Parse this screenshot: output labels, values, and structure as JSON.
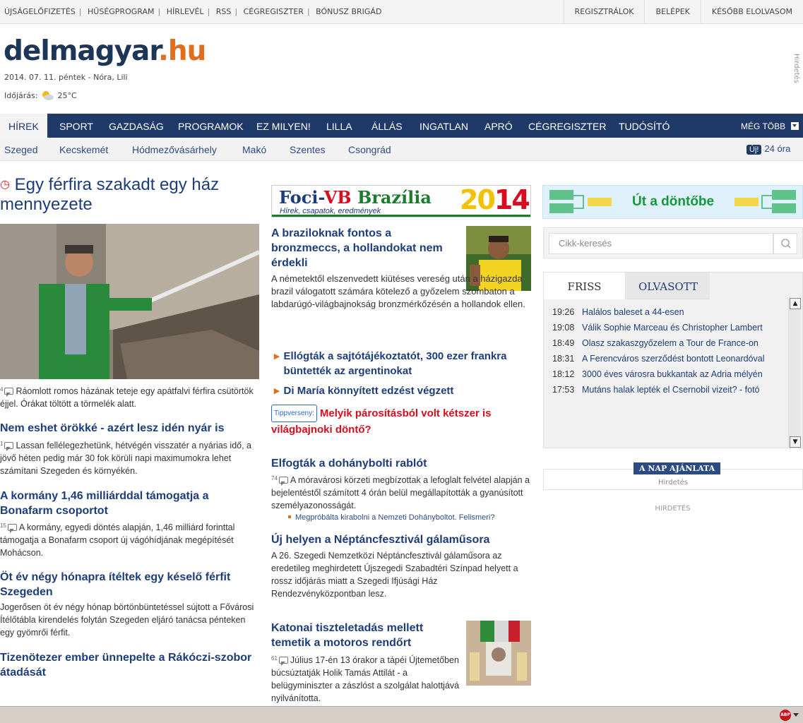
{
  "topbar": {
    "links": [
      "ÚJSÁGELŐFIZETÉS",
      "HŰSÉGPROGRAM",
      "HÍRLEVÉL",
      "RSS",
      "CÉGREGISZTER",
      "BÓNUSZ BRIGÁD"
    ],
    "right": [
      "REGISZTRÁLOK",
      "BELÉPEK",
      "KÉSŐBB ELOLVASOM"
    ]
  },
  "header": {
    "logo_main": "delmagyar",
    "logo_tld": ".hu",
    "date": "2014. 07. 11. péntek - Nóra, Lili",
    "weather_label": "Időjárás:",
    "weather_icon": "partly-cloudy-icon",
    "temperature": "25°C",
    "ad_vertical": "Hirdetés"
  },
  "nav": {
    "items": [
      "HÍREK",
      "SPORT",
      "GAZDASÁG",
      "PROGRAMOK",
      "EZ MILYEN!",
      "LILLA",
      "ÁLLÁS",
      "INGATLAN",
      "APRÓ",
      "CÉGREGISZTER",
      "TUDÓSÍTÓ"
    ],
    "more": "MÉG TÖBB"
  },
  "subnav": {
    "cities": [
      "Szeged",
      "Kecskemét",
      "Hódmezővásárhely",
      "Makó",
      "Szentes",
      "Csongrád"
    ],
    "uj_badge": "Új!",
    "uj_text": "24 óra"
  },
  "left": {
    "lead_title": "Egy férfira szakadt egy ház mennyezete",
    "lead_count": "4",
    "lead_body": "Ráomlott romos házának teteje egy apátfalvi férfira csütörtök éjjel. Órákat töltött a törmelék alatt.",
    "articles": [
      {
        "title": "Nem eshet örökké - azért lesz idén nyár is",
        "count": "1",
        "body": "Lassan fellélegezhetünk, hétvégén visszatér a nyárias idő, a jövő héten pedig már 30 fok körüli napi maximumokra lehet számítani Szegeden és környékén."
      },
      {
        "title": "A kormány 1,46 milliárddal támogatja a Bonafarm csoportot",
        "count": "15",
        "body": "A kormány, egyedi döntés alapján, 1,46 milliárd forinttal támogatja a Bonafarm csoport új vágóhídjának megépítését Mohácson."
      },
      {
        "title": "Öt év négy hónapra ítéltek egy késelő férfit Szegeden",
        "count": "",
        "body": "Jogerősen öt év négy hónap börtönbüntetéssel sújtott a Fővárosi Ítélőtábla kirendelés folytán Szegeden eljáró tanácsa pénteken egy gyömrői férfit."
      },
      {
        "title": "Tizenötezer ember ünnepelte a Rákóczi-szobor átadását",
        "count": "",
        "body": ""
      }
    ]
  },
  "middle": {
    "banner": {
      "t_foci": "Foci-",
      "t_vb": "VB",
      "t_brazil": " Brazília",
      "subtitle": "Hírek, csapatok, eredmények",
      "year_20": "20",
      "year_14": "14"
    },
    "lead_title": "A braziloknak fontos a bronzmeccs, a hollandokat nem érdekli",
    "lead_body": "A németektől elszenvedett kiütéses vereség után a házigazda brazil válogatott számára kötelező a győzelem szombaton a labdarúgó-világbajnokság bronzmérkőzésén a hollandok ellen.",
    "bullets": [
      "Ellógták a sajtótájékoztatót, 300 ezer frankra büntették az argentinokat",
      "Di María könnyített edzést végzett"
    ],
    "tipp_label": "Tippverseny:",
    "tipp_text": "Melyik párosításból volt kétszer is világbajnoki döntő?",
    "articles": [
      {
        "title": "Elfogták a dohánybolti rablót",
        "count": "74",
        "body": "A móravárosi körzeti megbízottak a lefoglalt felvétel alapján a bejelentéstől számított 4 órán belül megállapították a gyanúsított személyazonosságát.",
        "sub": "Megpróbálta kirabolni a Nemzeti Dohányboltot. Felismeri?"
      },
      {
        "title": "Új helyen a Néptáncfesztivál gálaműsora",
        "count": "",
        "body": "A 26. Szegedi Nemzetközi Néptáncfesztivál gálaműsora az eredetileg meghirdetett Újszegedi Szabadtéri Színpad helyett a rossz időjárás miatt a Szegedi Ifjúsági Ház Rendezvényközpontban lesz.",
        "sub": ""
      },
      {
        "title": "Katonai tiszteletadás mellett temetik a motoros rendőrt",
        "count": "61",
        "body": "Július 17-én 13 órakor a tápéi Újtemetőben búcsúztatják Holik Tamás Attilát - a belügyminiszter a zászlóst a szolgálat halottjává nyilvánította.",
        "sub": ""
      }
    ]
  },
  "right": {
    "banner_text": "Út a döntőbe",
    "search_placeholder": "Cikk-keresés",
    "tabs": [
      "FRISS",
      "OLVASOTT"
    ],
    "news": [
      {
        "time": "19:26",
        "text": "Halálos baleset a 44-esen"
      },
      {
        "time": "19:08",
        "text": "Válik Sophie Marceau és Christopher Lambert"
      },
      {
        "time": "18:49",
        "text": "Olasz szakaszgyőzelem a Tour de France-on"
      },
      {
        "time": "18:31",
        "text": "A Ferencváros szerződést bontott Leonardóval"
      },
      {
        "time": "18:12",
        "text": "3000 éves városra bukkantak az Adria mélyén"
      },
      {
        "time": "17:53",
        "text": "Mutáns halak lepték el Csernobil vizeit? - fotó"
      }
    ],
    "ajanlat_label": "A NAP AJÁNLATA",
    "ajanlat_ad": "Hirdetés",
    "hirdetes": "HIRDETÉS"
  },
  "statusbar": {
    "abp_label": "ABP"
  }
}
